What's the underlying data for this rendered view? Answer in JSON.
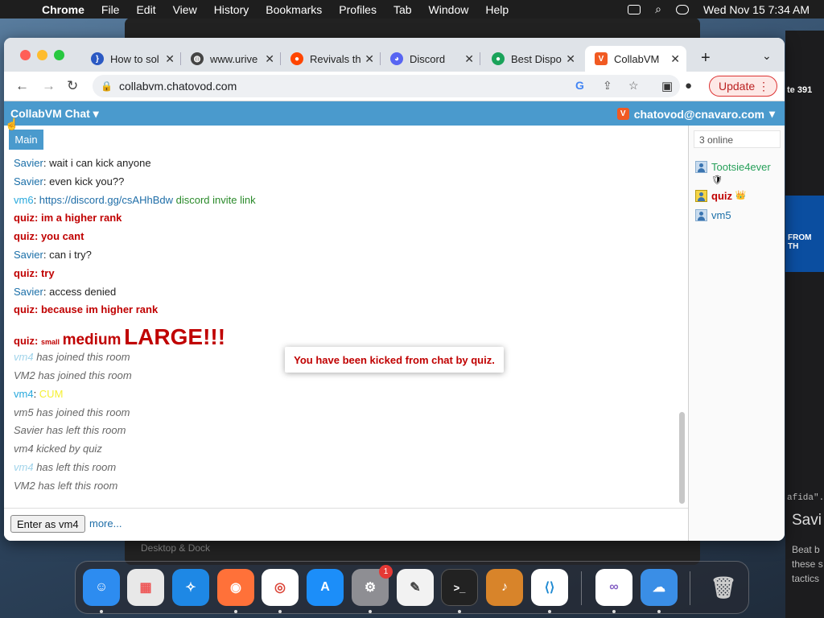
{
  "menubar": {
    "app": "Chrome",
    "items": [
      "File",
      "Edit",
      "View",
      "History",
      "Bookmarks",
      "Profiles",
      "Tab",
      "Window",
      "Help"
    ],
    "clock": "Wed Nov 15  7:34 AM"
  },
  "tabs": [
    {
      "label": "How to sol",
      "color": "#2b59c3"
    },
    {
      "label": "www.urive",
      "color": "#444444"
    },
    {
      "label": "Revivals th",
      "color": "#ff4500"
    },
    {
      "label": "Discord",
      "color": "#5865f2"
    },
    {
      "label": "Best Dispo",
      "color": "#1aa35a"
    },
    {
      "label": "CollabVM",
      "color": "#f15a22"
    }
  ],
  "address": {
    "url": "collabvm.chatovod.com"
  },
  "update_label": "Update",
  "page": {
    "brand": "CollabVM Chat",
    "user": "chatovod@cnavaro.com",
    "room_tab": "Main",
    "online_count": "3 online",
    "users": [
      {
        "name": "Tootsie4ever",
        "badge": "🛡"
      },
      {
        "name": "quiz",
        "badge": "👑"
      },
      {
        "name": "vm5",
        "badge": ""
      }
    ],
    "toast": "You have been kicked from chat by quiz.",
    "enter_button": "Enter as vm4",
    "more_link": "more..."
  },
  "chat": [
    {
      "user": "Savier",
      "text": "wait i can kick anyone"
    },
    {
      "user": "Savier",
      "text": "even kick you??"
    },
    {
      "user": "vm6",
      "link": "https://discord.gg/csAHhBdw",
      "text": "discord invite link"
    },
    {
      "user": "quiz",
      "text": "im a higher rank"
    },
    {
      "user": "quiz",
      "text": "you cant"
    },
    {
      "user": "Savier",
      "text": "can i try?"
    },
    {
      "user": "quiz",
      "text": "try"
    },
    {
      "user": "Savier",
      "text": "access denied"
    },
    {
      "user": "quiz",
      "text": "because im higher rank"
    },
    {
      "user": "quiz",
      "small": "small",
      "medium": "medium",
      "large": "LARGE!!!"
    },
    {
      "user": "vm4",
      "text": "has joined this room"
    },
    {
      "system": "VM2 has joined this room"
    },
    {
      "user": "vm4",
      "text": "CUM"
    },
    {
      "system": "vm5 has joined this room"
    },
    {
      "system": "Savier has left this room"
    },
    {
      "system": "vm4 kicked by quiz"
    },
    {
      "user": "vm4",
      "text": "has left this room"
    },
    {
      "system": "VM2 has left this room"
    }
  ],
  "background": {
    "right_snippets": [
      "te 391",
      "FROM TH",
      "afida\".",
      "Savi",
      "Beat b",
      "these s",
      "tactics"
    ],
    "finder_item": "Desktop & Dock"
  },
  "dock": [
    {
      "name": "Finder",
      "color": "#2d8cf0"
    },
    {
      "name": "Launchpad",
      "color": "#e8e8e8"
    },
    {
      "name": "Safari",
      "color": "#1e88e5"
    },
    {
      "name": "Firefox",
      "color": "#ff7139"
    },
    {
      "name": "Chrome",
      "color": "#ffffff"
    },
    {
      "name": "App Store",
      "color": "#1c8ef9"
    },
    {
      "name": "System Settings",
      "color": "#8e8e93",
      "badge": "1"
    },
    {
      "name": "TextEdit",
      "color": "#f2f2f2"
    },
    {
      "name": "Terminal",
      "color": "#222222"
    },
    {
      "name": "GarageBand",
      "color": "#d8842a"
    },
    {
      "name": "VS Code",
      "color": "#ffffff"
    },
    {
      "name": "Visual Studio",
      "color": "#ffffff"
    },
    {
      "name": "Weather",
      "color": "#3a8ee6"
    },
    {
      "name": "Trash",
      "color": "#b0b0b0"
    }
  ]
}
